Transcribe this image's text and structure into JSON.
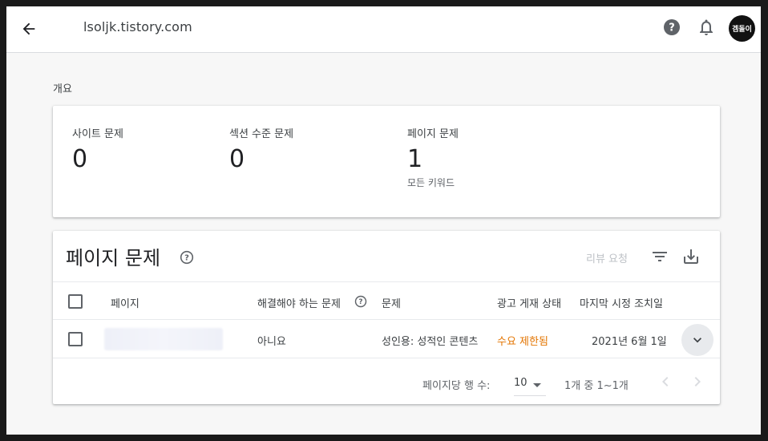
{
  "header": {
    "site": "lsoljk.tistory.com",
    "avatar_text": "겜돌이"
  },
  "overview": {
    "title": "개요",
    "stats": [
      {
        "label": "사이트 문제",
        "value": "0"
      },
      {
        "label": "섹션 수준 문제",
        "value": "0"
      },
      {
        "label": "페이지 문제",
        "value": "1",
        "sub": "모든 키워드"
      }
    ]
  },
  "issues": {
    "title": "페이지 문제",
    "review_label": "리뷰 요청",
    "columns": {
      "page": "페이지",
      "must_fix": "해결해야 하는 문제",
      "issue": "문제",
      "ad_status": "광고 게재 상태",
      "last_action": "마지막 시정 조치일"
    },
    "rows": [
      {
        "must_fix": "아니요",
        "issue": "성인용: 성적인 콘텐츠",
        "ad_status": "수요 제한됨",
        "last_action": "2021년 6월 1일"
      }
    ],
    "footer": {
      "rows_per_page_label": "페이지당 행 수:",
      "rows_per_page": "10",
      "range": "1개 중 1~1개"
    }
  },
  "colors": {
    "ad_status": "#e37400",
    "disabled": "#bdc1c6"
  }
}
